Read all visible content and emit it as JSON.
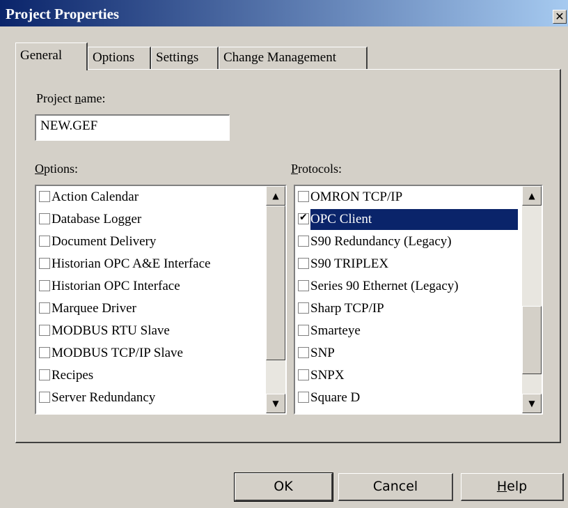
{
  "window": {
    "title": "Project Properties",
    "close_glyph": "✕"
  },
  "tabs": [
    {
      "label": "General",
      "active": true
    },
    {
      "label": "Options"
    },
    {
      "label": "Settings"
    },
    {
      "label": "Change Management"
    }
  ],
  "project_name": {
    "label_pre": "Project ",
    "label_u": "n",
    "label_post": "ame:",
    "value": "NEW.GEF"
  },
  "options": {
    "label_u": "O",
    "label_post": "ptions:",
    "items": [
      "Action Calendar",
      "Database Logger",
      "Document Delivery",
      "Historian OPC A&E Interface",
      "Historian OPC Interface",
      "Marquee Driver",
      "MODBUS RTU Slave",
      "MODBUS TCP/IP Slave",
      "Recipes",
      "Server Redundancy"
    ]
  },
  "protocols": {
    "label_u": "P",
    "label_post": "rotocols:",
    "items": [
      {
        "label": "OMRON TCP/IP",
        "checked": false
      },
      {
        "label": "OPC Client",
        "checked": true,
        "selected": true
      },
      {
        "label": "S90 Redundancy (Legacy)",
        "checked": false
      },
      {
        "label": "S90 TRIPLEX",
        "checked": false
      },
      {
        "label": "Series 90 Ethernet (Legacy)",
        "checked": false
      },
      {
        "label": "Sharp TCP/IP",
        "checked": false
      },
      {
        "label": "Smarteye",
        "checked": false
      },
      {
        "label": "SNP",
        "checked": false
      },
      {
        "label": "SNPX",
        "checked": false
      },
      {
        "label": "Square D",
        "checked": false
      }
    ]
  },
  "buttons": {
    "ok": "OK",
    "cancel": "Cancel",
    "help_u": "H",
    "help_post": "elp"
  },
  "icons": {
    "scroll_up": "▲",
    "scroll_down": "▼",
    "check": "✔"
  }
}
